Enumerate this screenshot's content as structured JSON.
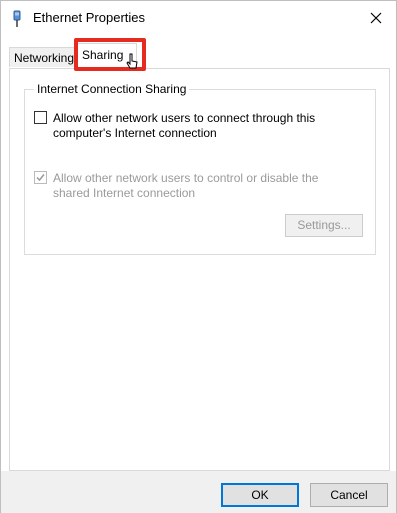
{
  "window": {
    "title": "Ethernet Properties",
    "icon": "network-adapter-icon",
    "close_icon": "close-icon"
  },
  "tabs": [
    {
      "label": "Networking",
      "selected": false
    },
    {
      "label": "Sharing",
      "selected": true
    }
  ],
  "sharing": {
    "group_title": "Internet Connection Sharing",
    "allow_connect": {
      "label": "Allow other network users to connect through this computer's Internet connection",
      "checked": false,
      "enabled": true
    },
    "allow_control": {
      "label": "Allow other network users to control or disable the shared Internet connection",
      "checked": true,
      "enabled": false
    },
    "settings_label": "Settings..."
  },
  "footer": {
    "ok_label": "OK",
    "cancel_label": "Cancel"
  },
  "colors": {
    "highlight": "#e52b20",
    "default_button_border": "#0078d7",
    "disabled_text": "#9a9a9a"
  }
}
